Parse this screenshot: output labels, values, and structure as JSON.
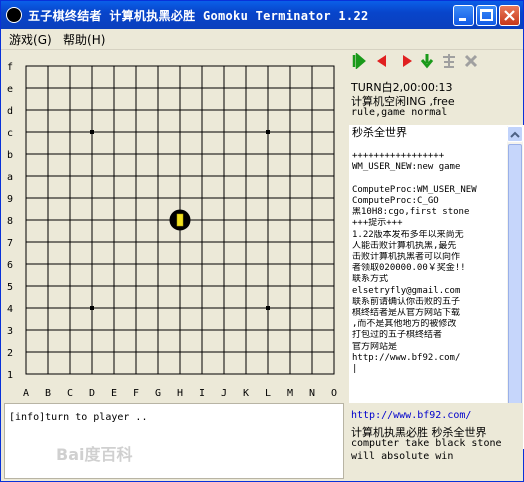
{
  "window": {
    "title": "五子棋终结者 计算机执黑必胜 Gomoku Terminator 1.22",
    "controls": [
      "minimize",
      "maximize",
      "close"
    ]
  },
  "menu": {
    "items": [
      {
        "label": "游戏",
        "accel": "(G)"
      },
      {
        "label": "帮助",
        "accel": "(H)"
      }
    ]
  },
  "board": {
    "rows": [
      "f",
      "e",
      "d",
      "c",
      "b",
      "a",
      "9",
      "8",
      "7",
      "6",
      "5",
      "4",
      "3",
      "2",
      "1"
    ],
    "columns": [
      "A",
      "B",
      "C",
      "D",
      "E",
      "F",
      "G",
      "H",
      "I",
      "J",
      "K",
      "L",
      "M",
      "N",
      "O"
    ],
    "star_points": [
      "D12",
      "L12",
      "D4",
      "L4"
    ],
    "stones": [
      {
        "color": "black",
        "position": "H8",
        "last_move": true
      }
    ]
  },
  "toolbar": {
    "icons": [
      {
        "name": "first-move-icon",
        "color": "#1a9a1a"
      },
      {
        "name": "undo-icon",
        "color": "#e02020"
      },
      {
        "name": "redo-icon",
        "color": "#e02020"
      },
      {
        "name": "last-move-icon",
        "color": "#1a9a1a"
      },
      {
        "name": "calculate-icon",
        "color": "#a0a0a0"
      },
      {
        "name": "stop-icon",
        "color": "#a0a0a0"
      }
    ]
  },
  "status": {
    "turn": "TURN白2,00:00:13",
    "mode": "计算机空闲ING ,free",
    "rule": "rule,game normal"
  },
  "log": {
    "lines": [
      "秒杀全世界",
      "",
      "+++++++++++++++++",
      "WM_USER_NEW:new game",
      "",
      "ComputeProc:WM_USER_NEW",
      "ComputeProc:C_GO",
      "黑10H8:cgo,first stone",
      "+++提示+++",
      "1.22版本发布多年以来尚无",
      "人能击败计算机执黑,最先",
      "击败计算机执黑者可以向作",
      "者领取020000.00￥奖金!!",
      "联系方式",
      "elsetryfly@gmail.com",
      "联系前请确认你击败的五子",
      "棋终结者是从官方网站下载",
      ",而不是其他地方的被修改",
      "打包过的五子棋终结者",
      "官方网站是",
      "http://www.bf92.com/",
      "|"
    ]
  },
  "message": {
    "text": "[info]turn to player .."
  },
  "footer": {
    "url": "http://www.bf92.com/",
    "line1": "计算机执黑必胜 秒杀全世界",
    "line2": "computer take black stone",
    "line3": "will absolute win"
  },
  "watermark": {
    "text": "Bai度百科"
  }
}
